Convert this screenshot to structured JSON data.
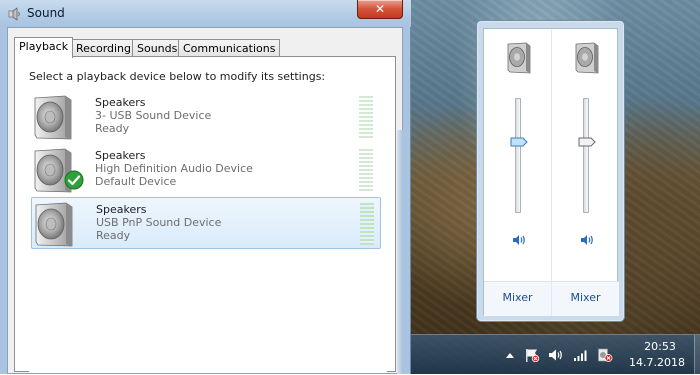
{
  "dialog": {
    "title": "Sound",
    "close_label": "✕",
    "tabs": [
      {
        "label": "Playback",
        "active": true
      },
      {
        "label": "Recording",
        "active": false
      },
      {
        "label": "Sounds",
        "active": false
      },
      {
        "label": "Communications",
        "active": false
      }
    ],
    "instruction": "Select a playback device below to modify its settings:",
    "devices": [
      {
        "name": "Speakers",
        "description": "3- USB Sound Device",
        "status": "Ready",
        "is_default": false,
        "selected": false
      },
      {
        "name": "Speakers",
        "description": "High Definition Audio Device",
        "status": "Default Device",
        "is_default": true,
        "selected": false
      },
      {
        "name": "Speakers",
        "description": "USB PnP Sound Device",
        "status": "Ready",
        "is_default": false,
        "selected": true
      }
    ]
  },
  "mixer": {
    "channels": [
      {
        "icon": "speaker-icon",
        "volume_fraction": 0.62,
        "mute_icon": "speaker-volume-icon",
        "link_label": "Mixer"
      },
      {
        "icon": "speaker-icon",
        "volume_fraction": 0.62,
        "mute_icon": "speaker-volume-icon",
        "link_label": "Mixer"
      }
    ]
  },
  "taskbar": {
    "tray_icons": [
      "show-hidden-icons-chevron",
      "action-center-flag-icon",
      "volume-icon",
      "network-signal-icon",
      "speaker-disabled-icon"
    ],
    "time": "20:53",
    "date": "14.7.2018"
  },
  "colors": {
    "link": "#1a4d8c",
    "selection": "#d9ebfb",
    "close_button": "#c23a1f"
  }
}
